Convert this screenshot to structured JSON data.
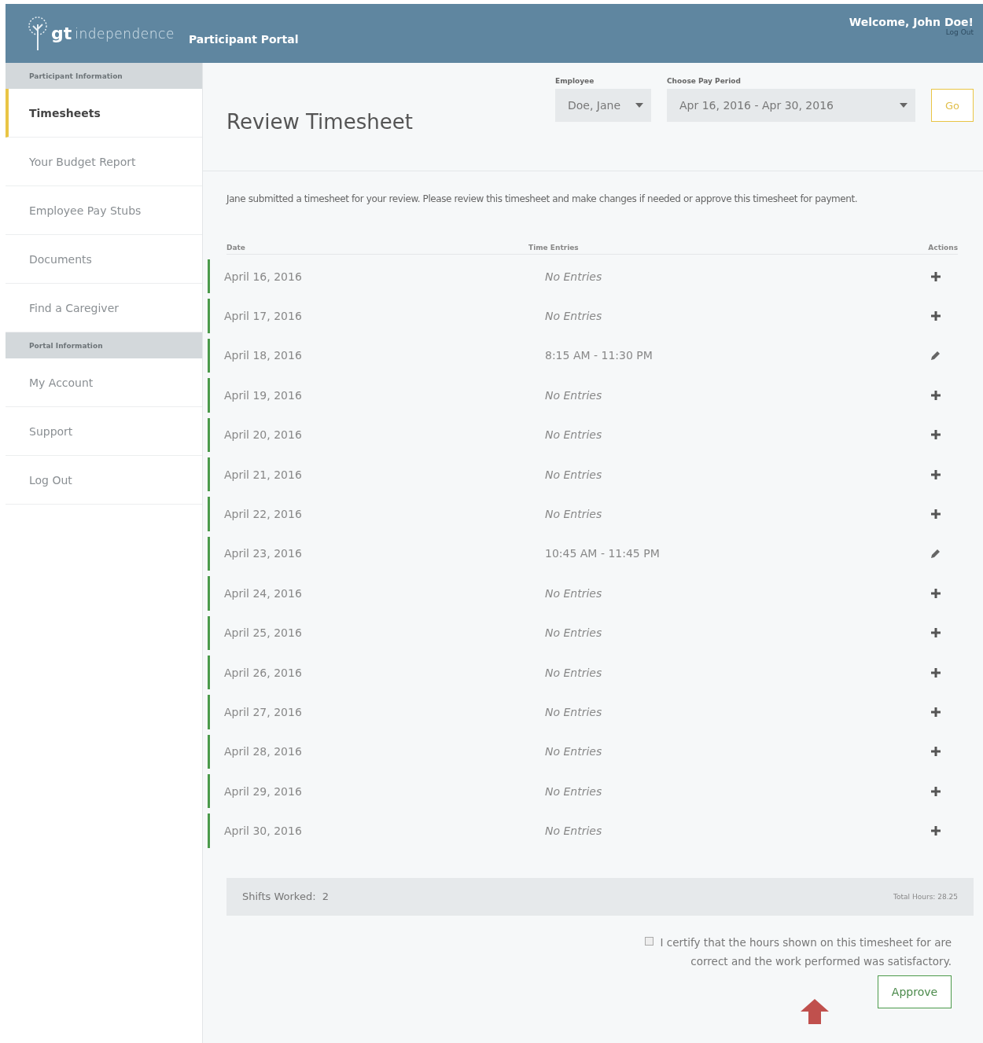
{
  "header": {
    "logo": {
      "mark": "gt",
      "word": "independence"
    },
    "portal": "Participant Portal",
    "welcome": "Welcome, John Doe!",
    "logout": "Log Out"
  },
  "sidebar": {
    "sections": [
      {
        "heading": "Participant Information",
        "items": [
          {
            "label": "Timesheets",
            "selected": true
          },
          {
            "label": "Your Budget Report",
            "selected": false
          },
          {
            "label": "Employee Pay Stubs",
            "selected": false
          },
          {
            "label": "Documents",
            "selected": false
          },
          {
            "label": "Find a Caregiver",
            "selected": false
          }
        ]
      },
      {
        "heading": "Portal Information",
        "items": [
          {
            "label": "My Account",
            "selected": false
          },
          {
            "label": "Support",
            "selected": false
          },
          {
            "label": "Log Out",
            "selected": false
          }
        ]
      }
    ]
  },
  "title": "Review Timesheet",
  "filters": {
    "employee": {
      "label": "Employee",
      "value": "Doe, Jane"
    },
    "period": {
      "label": "Choose Pay Period",
      "value": "Apr 16, 2016 - Apr 30, 2016"
    },
    "go": "Go"
  },
  "message": "Jane submitted a timesheet for your review. Please review this timesheet and make changes if needed or approve this timesheet for payment.",
  "table": {
    "columns": [
      "Date",
      "Time Entries",
      "Actions"
    ],
    "rows": [
      {
        "date": "April 16, 2016",
        "entries": "No Entries",
        "kind": "empty"
      },
      {
        "date": "April 17, 2016",
        "entries": "No Entries",
        "kind": "empty"
      },
      {
        "date": "April 18, 2016",
        "entries": "8:15 AM - 11:30 PM",
        "kind": "entry"
      },
      {
        "date": "April 19, 2016",
        "entries": "No Entries",
        "kind": "empty"
      },
      {
        "date": "April 20, 2016",
        "entries": "No Entries",
        "kind": "empty"
      },
      {
        "date": "April 21, 2016",
        "entries": "No Entries",
        "kind": "empty"
      },
      {
        "date": "April 22, 2016",
        "entries": "No Entries",
        "kind": "empty"
      },
      {
        "date": "April 23, 2016",
        "entries": "10:45 AM - 11:45 PM",
        "kind": "entry"
      },
      {
        "date": "April 24, 2016",
        "entries": "No Entries",
        "kind": "empty"
      },
      {
        "date": "April 25, 2016",
        "entries": "No Entries",
        "kind": "empty"
      },
      {
        "date": "April 26, 2016",
        "entries": "No Entries",
        "kind": "empty"
      },
      {
        "date": "April 27, 2016",
        "entries": "No Entries",
        "kind": "empty"
      },
      {
        "date": "April 28, 2016",
        "entries": "No Entries",
        "kind": "empty"
      },
      {
        "date": "April 29, 2016",
        "entries": "No Entries",
        "kind": "empty"
      },
      {
        "date": "April 30, 2016",
        "entries": "No Entries",
        "kind": "empty"
      }
    ]
  },
  "summary": {
    "shifts": "Shifts Worked:  2",
    "total": "Total Hours: 28.25"
  },
  "certify": {
    "text": "I certify that the hours shown on this timesheet for are correct and the work performed was satisfactory.",
    "checked": false
  },
  "approve": "Approve"
}
